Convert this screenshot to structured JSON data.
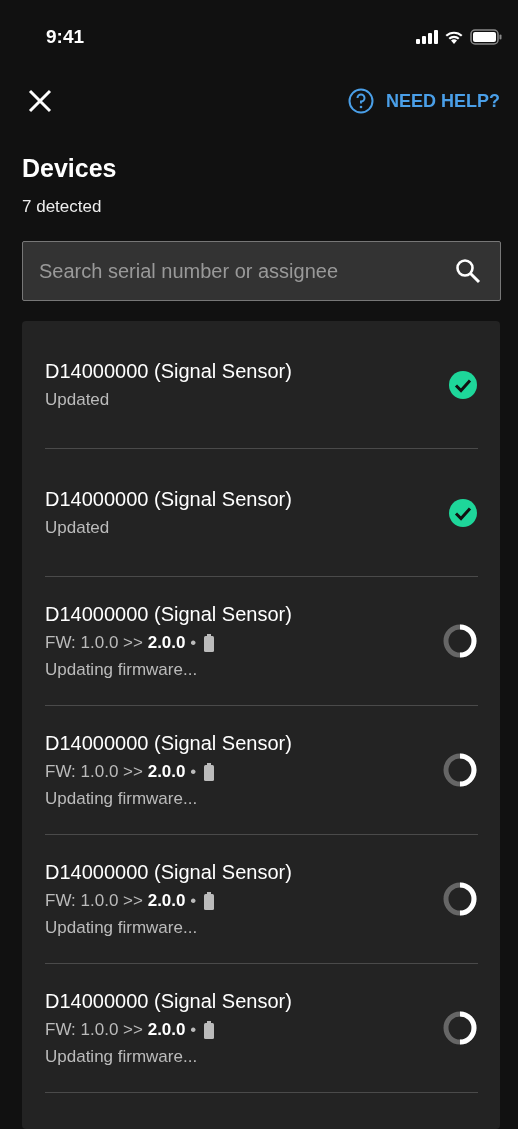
{
  "status_bar": {
    "time": "9:41"
  },
  "header": {
    "help_label": "NEED HELP?"
  },
  "title": "Devices",
  "subtitle": "7 detected",
  "search": {
    "placeholder": "Search serial number or assignee"
  },
  "devices": [
    {
      "kind": "updated",
      "name": "D14000000 (Signal Sensor)",
      "status": "Updated"
    },
    {
      "kind": "updated",
      "name": "D14000000 (Signal Sensor)",
      "status": "Updated"
    },
    {
      "kind": "updating",
      "name": "D14000000 (Signal Sensor)",
      "firmware": "FW: 1.0.0 >> **2.0.0** •",
      "status": "Updating firmware..."
    },
    {
      "kind": "updating",
      "name": "D14000000 (Signal Sensor)",
      "firmware": "FW: 1.0.0 >> **2.0.0** •",
      "status": "Updating firmware..."
    },
    {
      "kind": "updating",
      "name": "D14000000 (Signal Sensor)",
      "firmware": "FW: 1.0.0 >> **2.0.0** •",
      "status": "Updating firmware..."
    },
    {
      "kind": "updating",
      "name": "D14000000 (Signal Sensor)",
      "firmware": "FW: 1.0.0 >> **2.0.0** •",
      "status": "Updating firmware..."
    }
  ]
}
